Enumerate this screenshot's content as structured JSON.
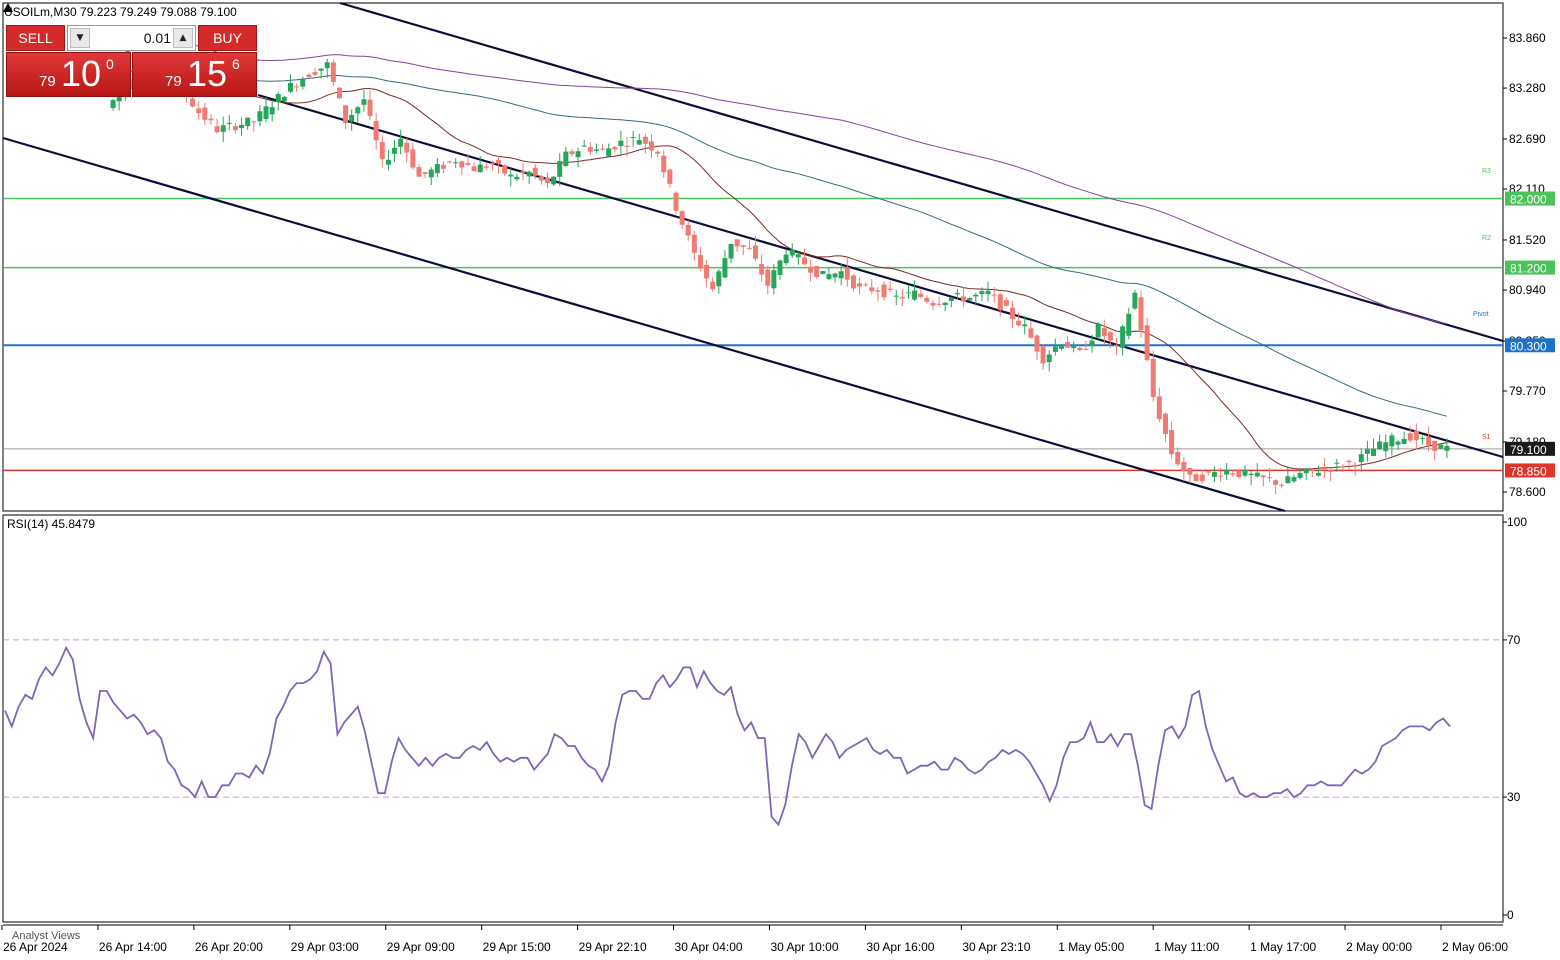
{
  "header": {
    "title": "USOILm,M30  79.223 79.249 79.088 79.100"
  },
  "trade_panel": {
    "sell_label": "SELL",
    "buy_label": "BUY",
    "lot": "0.01",
    "sell_price": {
      "prefix": "79",
      "big": "10",
      "sup": "0"
    },
    "buy_price": {
      "prefix": "79",
      "big": "15",
      "sup": "6"
    }
  },
  "rsi_label": "RSI(14) 45.8479",
  "footer_text": "Analyst Views",
  "pivot_labels": {
    "r3": "R3",
    "r2": "R2",
    "pivot": "Pivot",
    "s1": "S1"
  },
  "colors": {
    "bull": "#26a65b",
    "bear": "#ef7b72",
    "rsi": "#8064b8",
    "green_level": "#4cc25a",
    "blue_level": "#1e73c8",
    "red_level": "#e0352b",
    "channel": "#0d0d3a"
  },
  "chart_data": [
    {
      "type": "candlestick",
      "symbol": "USOILm",
      "timeframe": "M30",
      "ylim": [
        78.36,
        84.25
      ],
      "x_ticks": [
        "26 Apr 2024",
        "26 Apr 14:00",
        "26 Apr 20:00",
        "29 Apr 03:00",
        "29 Apr 09:00",
        "29 Apr 15:00",
        "29 Apr 22:10",
        "30 Apr 04:00",
        "30 Apr 10:00",
        "30 Apr 16:00",
        "30 Apr 23:10",
        "1 May 05:00",
        "1 May 11:00",
        "1 May 17:00",
        "2 May 00:00",
        "2 May 06:00"
      ],
      "y_ticks": [
        "83.860",
        "83.280",
        "82.690",
        "82.110",
        "81.520",
        "80.940",
        "80.350",
        "79.770",
        "79.180",
        "78.600"
      ],
      "levels": [
        {
          "value": 82.0,
          "label": "82.000",
          "color": "#4cc25a"
        },
        {
          "value": 81.2,
          "label": "81.200",
          "color": "#4cc25a"
        },
        {
          "value": 80.3,
          "label": "80.300",
          "color": "#1e73c8"
        },
        {
          "value": 78.85,
          "label": "78.850",
          "color": "#e0352b"
        }
      ],
      "current_price": {
        "value": 79.1,
        "label": "79.100"
      },
      "price_path": [
        83.05,
        83.3,
        83.45,
        83.4,
        83.3,
        83.0,
        82.8,
        82.85,
        82.9,
        83.1,
        83.3,
        83.45,
        83.55,
        82.9,
        83.15,
        82.4,
        82.7,
        82.25,
        82.35,
        82.45,
        82.35,
        82.4,
        82.25,
        82.3,
        82.15,
        82.5,
        82.6,
        82.55,
        82.65,
        82.7,
        82.55,
        81.9,
        81.35,
        80.95,
        81.5,
        81.4,
        81.0,
        81.4,
        81.25,
        81.1,
        81.15,
        80.95,
        80.95,
        80.85,
        80.9,
        80.8,
        80.85,
        80.85,
        80.9,
        80.7,
        80.5,
        80.15,
        80.35,
        80.2,
        80.5,
        80.25,
        80.9,
        79.7,
        79.05,
        78.75,
        78.8,
        78.85,
        78.8,
        78.75,
        78.7,
        78.8,
        78.85,
        78.9,
        78.95,
        79.1,
        79.2,
        79.25,
        79.15,
        79.1
      ]
    },
    {
      "type": "line",
      "name": "RSI(14)",
      "ylim": [
        0,
        100
      ],
      "y_ticks": [
        "100",
        "70",
        "30",
        "0"
      ],
      "levels": [
        70,
        30
      ],
      "values": [
        52,
        48,
        53,
        56,
        55,
        60,
        63,
        61,
        64,
        68,
        65,
        55,
        49,
        45,
        57,
        57,
        54,
        52,
        50,
        51,
        49,
        46,
        47,
        45,
        39,
        37,
        33,
        32,
        30,
        34,
        30,
        30,
        33,
        33,
        36,
        36,
        35,
        38,
        36,
        41,
        50,
        53,
        57,
        59,
        59,
        60,
        62,
        67,
        64,
        46,
        49,
        51,
        53,
        47,
        39,
        31,
        31,
        39,
        45,
        42,
        40,
        38,
        40,
        38,
        40,
        41,
        40,
        40,
        42,
        43,
        42,
        44,
        41,
        39,
        40,
        39,
        40,
        40,
        37,
        39,
        41,
        46,
        45,
        43,
        43,
        40,
        38,
        37,
        34,
        38,
        49,
        56,
        57,
        57,
        55,
        55,
        59,
        61,
        58,
        60,
        63,
        63,
        58,
        62,
        59,
        57,
        56,
        58,
        51,
        47,
        49,
        45,
        45,
        25,
        23,
        28,
        38,
        46,
        44,
        40,
        43,
        46,
        44,
        40,
        42,
        43,
        44,
        45,
        42,
        41,
        42,
        40,
        40,
        36,
        37,
        38,
        38,
        39,
        37,
        37,
        40,
        39,
        37,
        36,
        37,
        39,
        40,
        42,
        41,
        42,
        41,
        39,
        36,
        33,
        29,
        33,
        40,
        44,
        44,
        45,
        49,
        44,
        44,
        46,
        43,
        46,
        46,
        38,
        28,
        27,
        38,
        47,
        48,
        45,
        48,
        56,
        57,
        48,
        42,
        38,
        34,
        35,
        31,
        30,
        31,
        30,
        30,
        31,
        31,
        32,
        30,
        31,
        33,
        33,
        34,
        33,
        33,
        33,
        35,
        37,
        36,
        37,
        39,
        43,
        44,
        45,
        47,
        48,
        48,
        48,
        47,
        49,
        50,
        48
      ]
    }
  ]
}
